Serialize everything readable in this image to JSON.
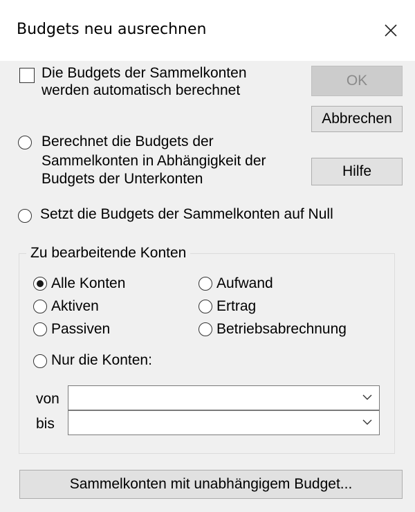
{
  "dialog": {
    "title": "Budgets neu ausrechnen"
  },
  "options": {
    "auto_checkbox_line1": "Die Budgets der Sammelkonten",
    "auto_checkbox_line2": "werden automatisch berechnet",
    "auto_checked": false,
    "radio_calc_line1": "Berechnet die Budgets der",
    "radio_calc_line2": "Sammelkonten in Abhängigkeit der",
    "radio_calc_line3": "Budgets der Unterkonten",
    "radio_zero": "Setzt die Budgets der Sammelkonten auf Null"
  },
  "buttons": {
    "ok": "OK",
    "cancel": "Abbrechen",
    "help": "Hilfe",
    "independent": "Sammelkonten mit unabhängigem Budget..."
  },
  "accounts_group": {
    "legend": "Zu bearbeitende Konten",
    "selected": "Alle Konten",
    "options": {
      "all": "Alle Konten",
      "assets": "Aktiven",
      "liabilities": "Passiven",
      "expense": "Aufwand",
      "income": "Ertrag",
      "operating": "Betriebsabrechnung",
      "only": "Nur die Konten:"
    },
    "from_label": "von",
    "to_label": "bis",
    "from_value": "",
    "to_value": ""
  }
}
